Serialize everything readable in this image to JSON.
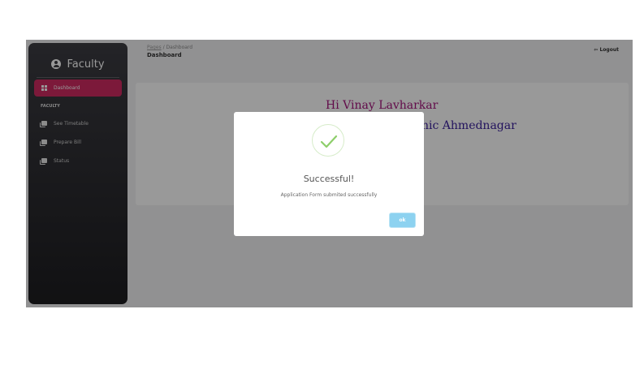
{
  "sidebar": {
    "brand": "Faculty",
    "active_item": "Dashboard",
    "section_label": "FACULTY",
    "items": [
      {
        "label": "See Timetable",
        "icon": "file-copy-icon"
      },
      {
        "label": "Prepare Bill",
        "icon": "file-copy-icon"
      },
      {
        "label": "Status",
        "icon": "file-copy-icon"
      }
    ],
    "accent_color": "#cf2a62"
  },
  "header": {
    "breadcrumb_link": "Pages",
    "breadcrumb_sep": "/",
    "breadcrumb_current": "Dashboard",
    "title": "Dashboard",
    "logout_label": "Logout"
  },
  "card": {
    "greeting": "Hi Vinay Lavharkar",
    "college_fragment": "nic Ahmednagar"
  },
  "modal": {
    "title": "Successful!",
    "message": "Application Form submited successfully",
    "ok_label": "ok",
    "icon": "check-icon"
  }
}
